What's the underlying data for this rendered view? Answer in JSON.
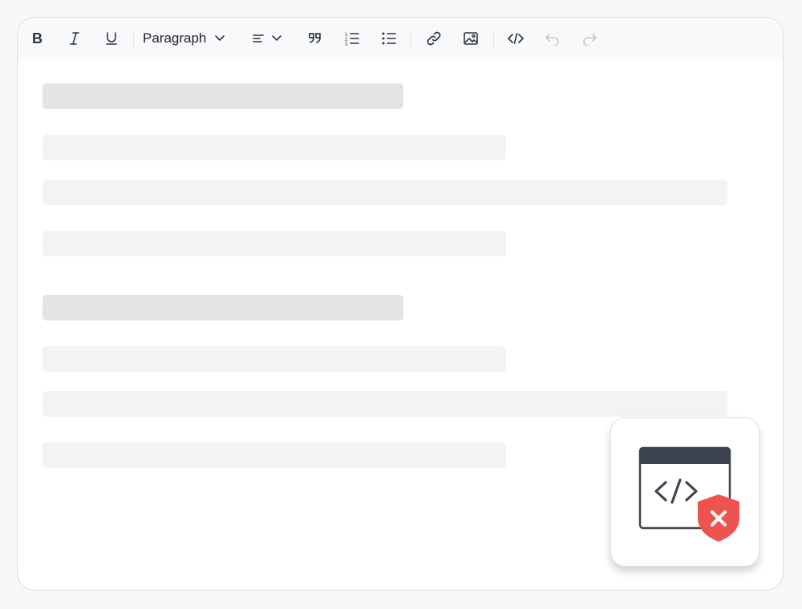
{
  "toolbar": {
    "bold_icon": "bold-icon",
    "italic_icon": "italic-icon",
    "underline_icon": "underline-icon",
    "block_format": {
      "selected": "Paragraph"
    },
    "align_icon": "align-left-icon",
    "quote_icon": "blockquote-icon",
    "ordered_list_icon": "ordered-list-icon",
    "bullet_list_icon": "bullet-list-icon",
    "link_icon": "link-icon",
    "image_icon": "image-icon",
    "code_icon": "code-icon",
    "undo_icon": "undo-icon",
    "redo_icon": "redo-icon"
  },
  "badge": {
    "icon": "code-window-blocked-icon",
    "colors": {
      "window": "#3d4450",
      "shield": "#ef5350",
      "x": "#ffffff"
    }
  },
  "colors": {
    "icon": "#2f3540",
    "icon_disabled": "#c4c8cd",
    "skeleton_heading": "#e4e4e4",
    "skeleton_line": "#f3f3f3"
  }
}
